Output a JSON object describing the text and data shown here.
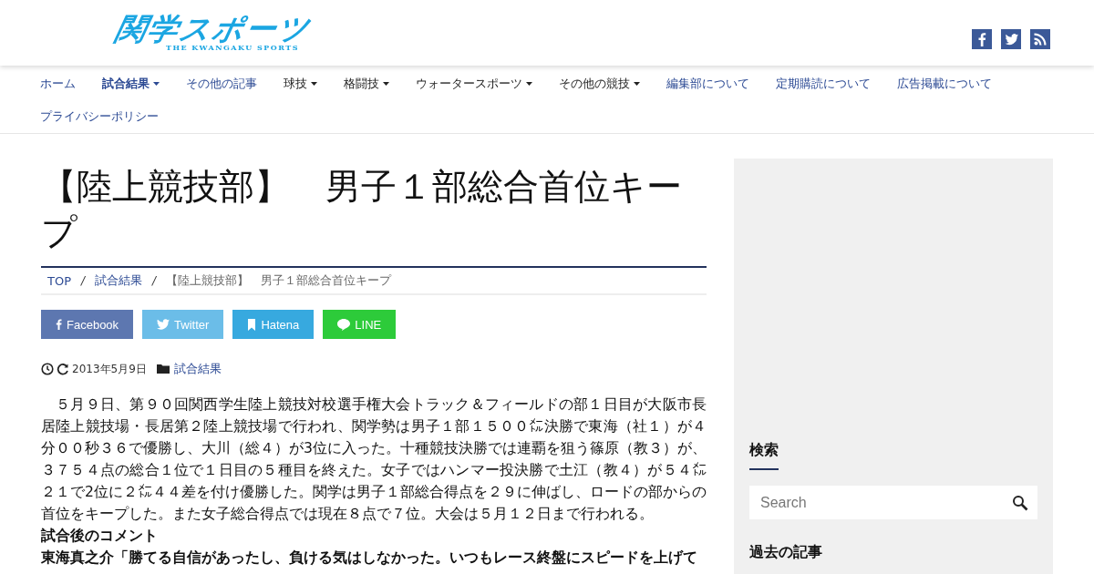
{
  "logo": {
    "title": "関学スポーツ",
    "subtitle": "THE KWANGAKU SPORTS"
  },
  "social_icons": [
    {
      "kind": "facebook"
    },
    {
      "kind": "twitter"
    },
    {
      "kind": "rss"
    }
  ],
  "nav": [
    {
      "label": "ホーム",
      "selected": false,
      "dropdown": false,
      "kind": "link"
    },
    {
      "label": "試合結果",
      "selected": true,
      "dropdown": true,
      "kind": "link"
    },
    {
      "label": "その他の記事",
      "selected": false,
      "dropdown": false,
      "kind": "link"
    },
    {
      "label": "球技",
      "selected": false,
      "dropdown": true,
      "kind": "menu"
    },
    {
      "label": "格闘技",
      "selected": false,
      "dropdown": true,
      "kind": "menu"
    },
    {
      "label": "ウォータースポーツ",
      "selected": false,
      "dropdown": true,
      "kind": "menu"
    },
    {
      "label": "その他の競技",
      "selected": false,
      "dropdown": true,
      "kind": "menu"
    },
    {
      "label": "編集部について",
      "selected": false,
      "dropdown": false,
      "kind": "link"
    },
    {
      "label": "定期購読について",
      "selected": false,
      "dropdown": false,
      "kind": "link"
    },
    {
      "label": "広告掲載について",
      "selected": false,
      "dropdown": false,
      "kind": "link"
    },
    {
      "label": "プライバシーポリシー",
      "selected": false,
      "dropdown": false,
      "kind": "link"
    }
  ],
  "article": {
    "title": "【陸上競技部】　男子１部総合首位キープ",
    "breadcrumb_separator": "/",
    "breadcrumb": [
      {
        "label": "TOP",
        "kind": "link"
      },
      {
        "label": "試合結果",
        "kind": "link"
      },
      {
        "label": "【陸上競技部】　男子１部総合首位キープ",
        "kind": "current"
      }
    ],
    "share_buttons": [
      {
        "label": "Facebook",
        "kind": "facebook",
        "color": "#5d77b0"
      },
      {
        "label": "Twitter",
        "kind": "twitter",
        "color": "#6bbde8"
      },
      {
        "label": "Hatena",
        "kind": "hatena",
        "color": "#37a9df"
      },
      {
        "label": "LINE",
        "kind": "line",
        "color": "#2dcb3a"
      }
    ],
    "date": "2013年5月9日",
    "category": "試合結果",
    "body": "　５月９日、第９０回関西学生陸上競技対校選手権大会トラック＆フィールドの部１日目が大阪市長居陸上競技場・長居第２陸上競技場で行われ、関学勢は男子１部１５００㍍決勝で東海（社１）が４分００秒３６で優勝し、大川（総４）が3位に入った。十種競技決勝では連覇を狙う篠原（教３）が、３７５４点の総合１位で１日目の５種目を終えた。女子ではハンマー投決勝で土江（教４）が５４㍍２１で2位に２㍍４４差を付け優勝した。関学は男子１部総合得点を２９に伸ばし、ロードの部からの首位をキープした。また女子総合得点では現在８点で７位。大会は５月１２日まで行われる。",
    "comment_heading": "試合後のコメント",
    "comment": "東海真之介「勝てる自信があったし、負ける気はしなかった。いつもレース終盤にスピードを上げて"
  },
  "sidebar": {
    "search_heading": "検索",
    "search": {
      "placeholder": "Search"
    },
    "archive_heading": "過去の記事"
  }
}
